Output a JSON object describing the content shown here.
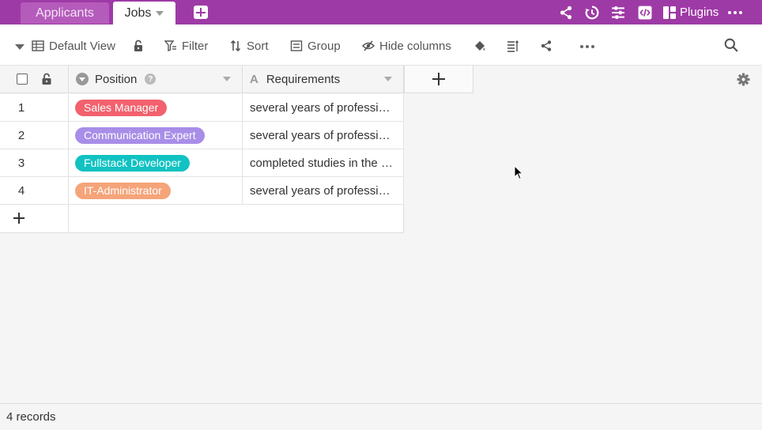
{
  "tabs": [
    {
      "label": "Applicants",
      "active": false
    },
    {
      "label": "Jobs",
      "active": true
    }
  ],
  "topbar": {
    "plugins_label": "Plugins",
    "icons": [
      "share-icon",
      "history-icon",
      "sliders-icon",
      "code-icon",
      "plugins-icon",
      "more-icon"
    ]
  },
  "toolbar": {
    "view_label": "Default View",
    "filter_label": "Filter",
    "sort_label": "Sort",
    "group_label": "Group",
    "hide_columns_label": "Hide columns"
  },
  "columns": {
    "position": "Position",
    "requirements": "Requirements"
  },
  "rows": [
    {
      "index": "1",
      "position": "Sales Manager",
      "color": "#f2616d",
      "requirements": "several years of professional experience"
    },
    {
      "index": "2",
      "position": "Communication Expert",
      "color": "#a88ee8",
      "requirements": "several years of professional experience"
    },
    {
      "index": "3",
      "position": "Fullstack Developer",
      "color": "#11c2c2",
      "requirements": "completed studies in the field"
    },
    {
      "index": "4",
      "position": "IT-Administrator",
      "color": "#f5a47a",
      "requirements": "several years of professional experience"
    }
  ],
  "status": {
    "records": "4 records"
  },
  "colors": {
    "brand": "#9e3aa6"
  }
}
